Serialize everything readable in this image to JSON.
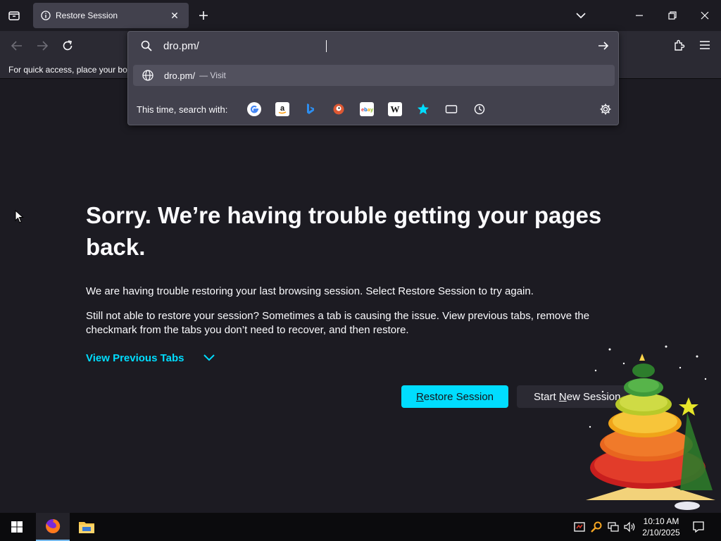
{
  "browser": {
    "tab": {
      "title": "Restore Session",
      "close_glyph": "✕",
      "icon": "info-icon"
    },
    "new_tab_glyph": "+",
    "bookmarks_hint": "For quick access, place your bookmarks here on the bookmarks toolbar.",
    "urlbar": {
      "value": "dro.pm/",
      "result_text": "dro.pm/",
      "result_action": "— Visit",
      "search_with_label": "This time, search with:",
      "engines": [
        "Google",
        "Amazon",
        "Bing",
        "DuckDuckGo",
        "eBay",
        "Wikipedia",
        "Bookmarks",
        "Tabs",
        "History"
      ]
    }
  },
  "page": {
    "title": "Sorry. We’re having trouble getting your pages back.",
    "paragraph1": "We are having trouble restoring your last browsing session. Select Restore Session to try again.",
    "paragraph2": "Still not able to restore your session? Sometimes a tab is causing the issue. View previous tabs, remove the checkmark from the tabs you don’t need to recover, and then restore.",
    "view_previous_tabs": "View Previous Tabs",
    "restore_button": {
      "accel": "R",
      "rest": "estore Session"
    },
    "new_session_button": {
      "pre": "Start ",
      "accel": "N",
      "rest": "ew Session"
    }
  },
  "taskbar": {
    "time": "10:10 AM",
    "date": "2/10/2025"
  },
  "colors": {
    "accent": "#00ddff",
    "background": "#1c1b22",
    "toolbar": "#2b2a33",
    "popup": "#42414d"
  }
}
